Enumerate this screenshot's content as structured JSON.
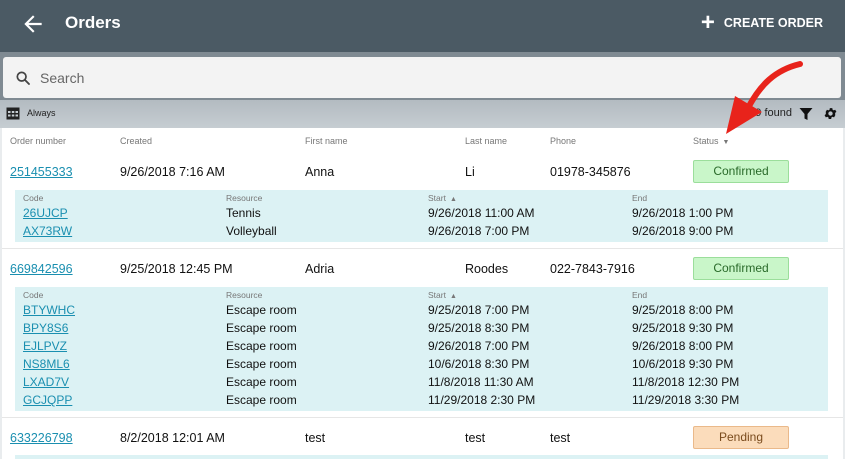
{
  "header": {
    "title": "Orders",
    "create_label": "CREATE ORDER"
  },
  "search": {
    "placeholder": "Search"
  },
  "toolbar": {
    "period": "Always",
    "found_text": "9 found"
  },
  "columns": {
    "order_number": "Order number",
    "created": "Created",
    "first_name": "First name",
    "last_name": "Last name",
    "phone": "Phone",
    "status": "Status"
  },
  "sub_columns": {
    "code": "Code",
    "resource": "Resource",
    "start": "Start",
    "end": "End"
  },
  "orders": [
    {
      "number": "251455333",
      "created": "9/26/2018 7:16 AM",
      "first": "Anna",
      "last": "Li",
      "phone": "01978-345876",
      "status": "Confirmed",
      "items": [
        {
          "code": "26UJCP",
          "resource": "Tennis",
          "start": "9/26/2018 11:00 AM",
          "end": "9/26/2018 1:00 PM"
        },
        {
          "code": "AX73RW",
          "resource": "Volleyball",
          "start": "9/26/2018 7:00 PM",
          "end": "9/26/2018 9:00 PM"
        }
      ]
    },
    {
      "number": "669842596",
      "created": "9/25/2018 12:45 PM",
      "first": "Adria",
      "last": "Roodes",
      "phone": "022-7843-7916",
      "status": "Confirmed",
      "items": [
        {
          "code": "BTYWHC",
          "resource": "Escape room",
          "start": "9/25/2018 7:00 PM",
          "end": "9/25/2018 8:00 PM"
        },
        {
          "code": "BPY8S6",
          "resource": "Escape room",
          "start": "9/25/2018 8:30 PM",
          "end": "9/25/2018 9:30 PM"
        },
        {
          "code": "EJLPVZ",
          "resource": "Escape room",
          "start": "9/26/2018 7:00 PM",
          "end": "9/26/2018 8:00 PM"
        },
        {
          "code": "NS8ML6",
          "resource": "Escape room",
          "start": "10/6/2018 8:30 PM",
          "end": "10/6/2018 9:30 PM"
        },
        {
          "code": "LXAD7V",
          "resource": "Escape room",
          "start": "11/8/2018 11:30 AM",
          "end": "11/8/2018 12:30 PM"
        },
        {
          "code": "GCJQPP",
          "resource": "Escape room",
          "start": "11/29/2018 2:30 PM",
          "end": "11/29/2018 3:30 PM"
        }
      ]
    },
    {
      "number": "633226798",
      "created": "8/2/2018 12:01 AM",
      "first": "test",
      "last": "test",
      "phone": "test",
      "status": "Pending",
      "items": []
    }
  ],
  "colors": {
    "topbar": "#4b5a64",
    "link": "#1a8fb0",
    "subgrid": "#dcf2f4",
    "annotation_arrow": "#e8231b"
  }
}
